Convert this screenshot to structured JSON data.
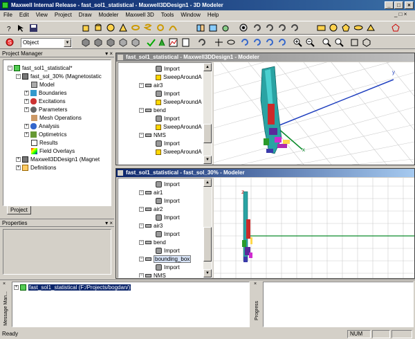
{
  "window": {
    "title": "Maxwell Internal Release - fast_sol1_statistical - Maxwell3DDesign1 - 3D Modeler"
  },
  "menu": [
    "File",
    "Edit",
    "View",
    "Project",
    "Draw",
    "Modeler",
    "Maxwell 3D",
    "Tools",
    "Window",
    "Help"
  ],
  "toolbar2": {
    "selection_combo": "Object"
  },
  "project_manager": {
    "title": "Project Manager",
    "tab": "Project",
    "tree": [
      {
        "label": "fast_sol1_statistical*"
      },
      {
        "label": "fast_sol_30% (Magnetostatic"
      },
      {
        "label": "Model"
      },
      {
        "label": "Boundaries"
      },
      {
        "label": "Excitations"
      },
      {
        "label": "Parameters"
      },
      {
        "label": "Mesh Operations"
      },
      {
        "label": "Analysis"
      },
      {
        "label": "Optimetrics"
      },
      {
        "label": "Results"
      },
      {
        "label": "Field Overlays"
      },
      {
        "label": "Maxwell3DDesign1 (Magnet"
      },
      {
        "label": "Definitions"
      }
    ]
  },
  "properties": {
    "title": "Properties"
  },
  "modeler1": {
    "title": "fast_sol1_statistical - Maxwell3DDesign1 - Modeler",
    "tree": [
      "Import",
      "SweepAroundA",
      "air3",
      "Import",
      "SweepAroundA",
      "bend",
      "Import",
      "SweepAroundA",
      "NMS",
      "Import",
      "SweepAroundA"
    ],
    "axes": {
      "y": "y",
      "x": "x"
    }
  },
  "modeler2": {
    "title": "fast_sol1_statistical - fast_sol_30% - Modeler",
    "tree": [
      "Import",
      "air1",
      "Import",
      "air2",
      "Import",
      "air3",
      "Import",
      "bend",
      "Import",
      "bounding_box",
      "Import",
      "NMS"
    ],
    "axes": {
      "z": "z"
    }
  },
  "message_manager": {
    "label": "Message Man...",
    "item": "fast_sol1_statistical (F:/Projects/bogdan/)"
  },
  "progress": {
    "label": "Progress"
  },
  "status": {
    "text": "Ready",
    "num": "NUM"
  }
}
